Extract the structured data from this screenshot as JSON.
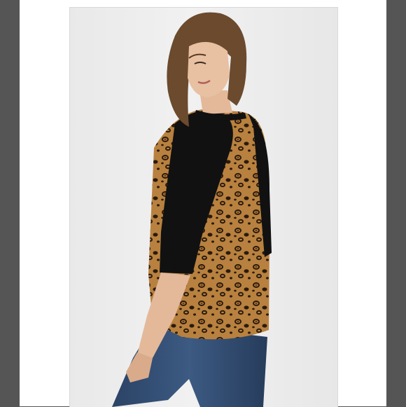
{
  "image": {
    "top_text": "",
    "subject": "model-wearing-leopard-raglan-top"
  },
  "colors": {
    "outer_background": "#555555",
    "frame_background": "#ffffff",
    "photo_background": "#ececec",
    "sleeve": "#111111",
    "leopard_base": "#b8813f",
    "leopard_spot": "#2a1a0c",
    "denim": "#2f4a6e",
    "skin": "#e3b99a",
    "hair": "#6b4a2e"
  }
}
